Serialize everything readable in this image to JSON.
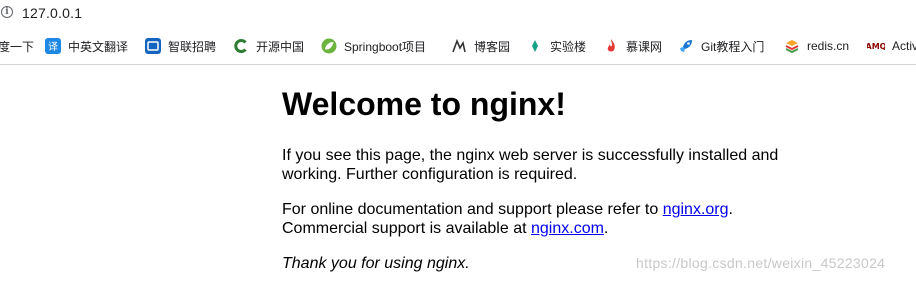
{
  "address_bar": {
    "url": "127.0.0.1",
    "info_icon": "info-icon"
  },
  "bookmarks": [
    {
      "label": "度一下",
      "icon": "baidu-icon",
      "color": "#2932e1"
    },
    {
      "label": "中英文翻译",
      "icon": "translate-icon",
      "color": "#1e88e5"
    },
    {
      "label": "智联招聘",
      "icon": "zhaopin-icon",
      "color": "#1565c0"
    },
    {
      "label": "开源中国",
      "icon": "oschina-icon",
      "color": "#2e7d32"
    },
    {
      "label": "Springboot项目",
      "icon": "spring-icon",
      "color": "#6db33f"
    },
    {
      "label": "博客园",
      "icon": "cnblogs-icon",
      "color": "#333333"
    },
    {
      "label": "实验楼",
      "icon": "shiyanlou-icon",
      "color": "#16a085"
    },
    {
      "label": "慕课网",
      "icon": "imooc-icon",
      "color": "#e53935"
    },
    {
      "label": "Git教程入门",
      "icon": "rocket-icon",
      "color": "#1976d2"
    },
    {
      "label": "redis.cn",
      "icon": "redis-icon",
      "color": "#f5a623"
    },
    {
      "label": "Activ",
      "icon": "amq-icon",
      "color": "#8b0000"
    }
  ],
  "page": {
    "title": "Welcome to nginx!",
    "p1": "If you see this page, the nginx web server is successfully installed and working. Further configuration is required.",
    "p2_prefix": "For online documentation and support please refer to ",
    "p2_link1": "nginx.org",
    "p2_mid": ".",
    "p2_line2_prefix": "Commercial support is available at ",
    "p2_link2": "nginx.com",
    "p2_suffix": ".",
    "p3": "Thank you for using nginx."
  },
  "watermark": "https://blog.csdn.net/weixin_45223024"
}
